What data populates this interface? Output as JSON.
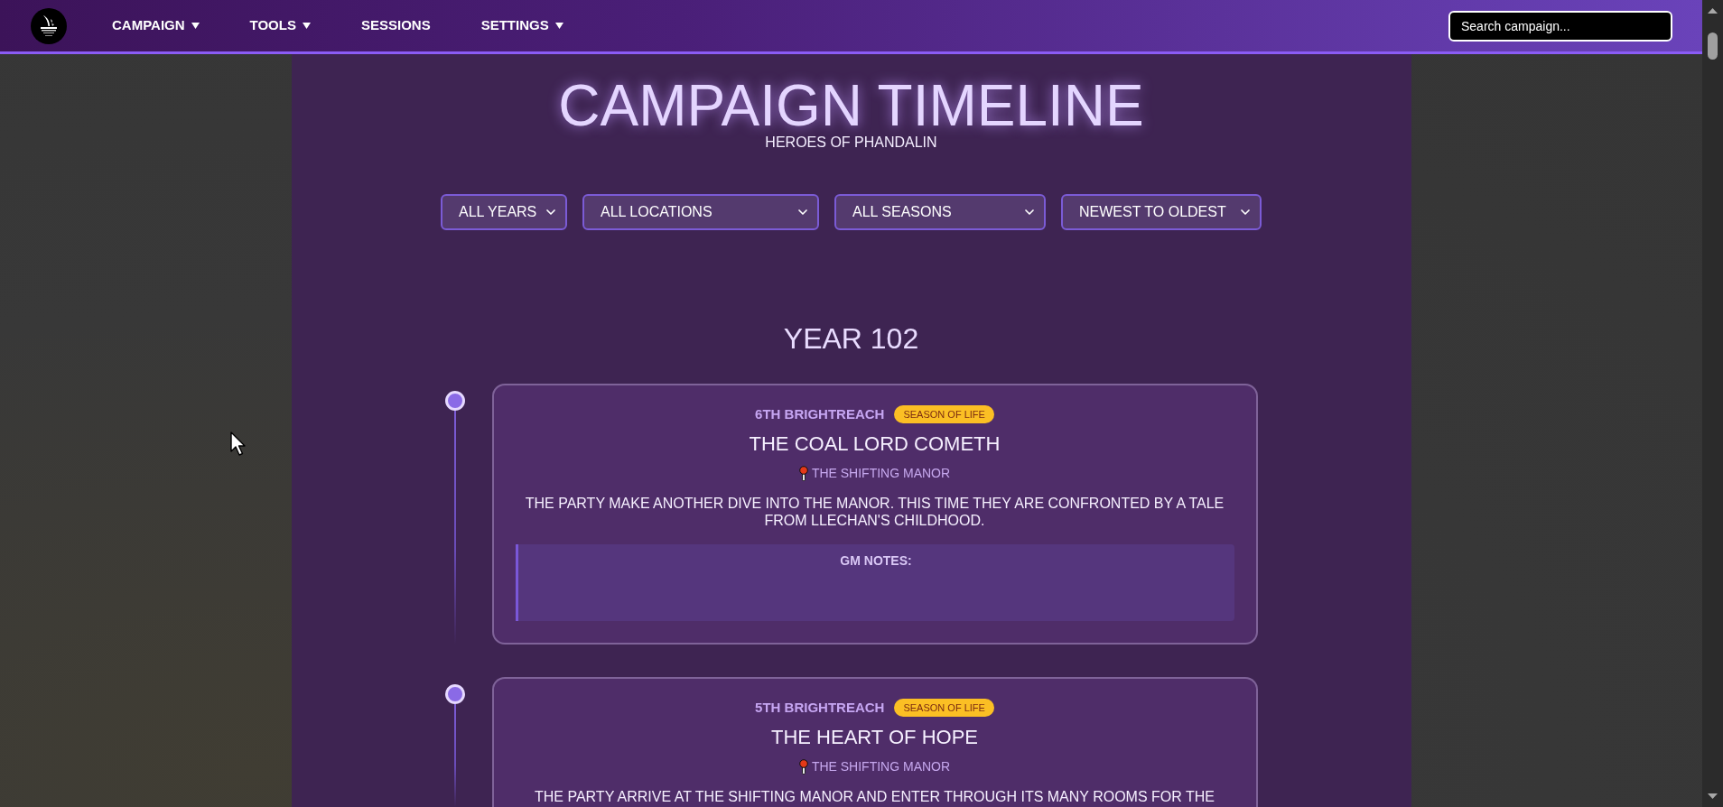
{
  "nav": {
    "items": [
      {
        "label": "CAMPAIGN",
        "dropdown": true
      },
      {
        "label": "TOOLS",
        "dropdown": true
      },
      {
        "label": "SESSIONS",
        "dropdown": false
      },
      {
        "label": "SETTINGS",
        "dropdown": true
      }
    ],
    "search": {
      "placeholder": "Search campaign..."
    }
  },
  "header": {
    "title": "CAMPAIGN TIMELINE",
    "subtitle": "HEROES OF PHANDALIN"
  },
  "filters": [
    {
      "value": "ALL YEARS"
    },
    {
      "value": "ALL LOCATIONS"
    },
    {
      "value": "ALL SEASONS"
    },
    {
      "value": "NEWEST TO OLDEST"
    }
  ],
  "years": [
    {
      "label": "YEAR 102",
      "events": [
        {
          "date": "6TH BRIGHTREACH",
          "season": "SEASON OF LIFE",
          "title": "THE COAL LORD COMETH",
          "location": "THE SHIFTING MANOR",
          "description": "THE PARTY MAKE ANOTHER DIVE INTO THE MANOR. THIS TIME THEY ARE CONFRONTED BY A TALE FROM LLECHAN'S CHILDHOOD.",
          "gm_notes": {
            "label": "GM NOTES:"
          }
        },
        {
          "date": "5TH BRIGHTREACH",
          "season": "SEASON OF LIFE",
          "title": "THE HEART OF HOPE",
          "location": "THE SHIFTING MANOR",
          "description": "THE PARTY ARRIVE AT THE SHIFTING MANOR AND ENTER THROUGH ITS MANY ROOMS FOR THE"
        }
      ]
    }
  ]
}
